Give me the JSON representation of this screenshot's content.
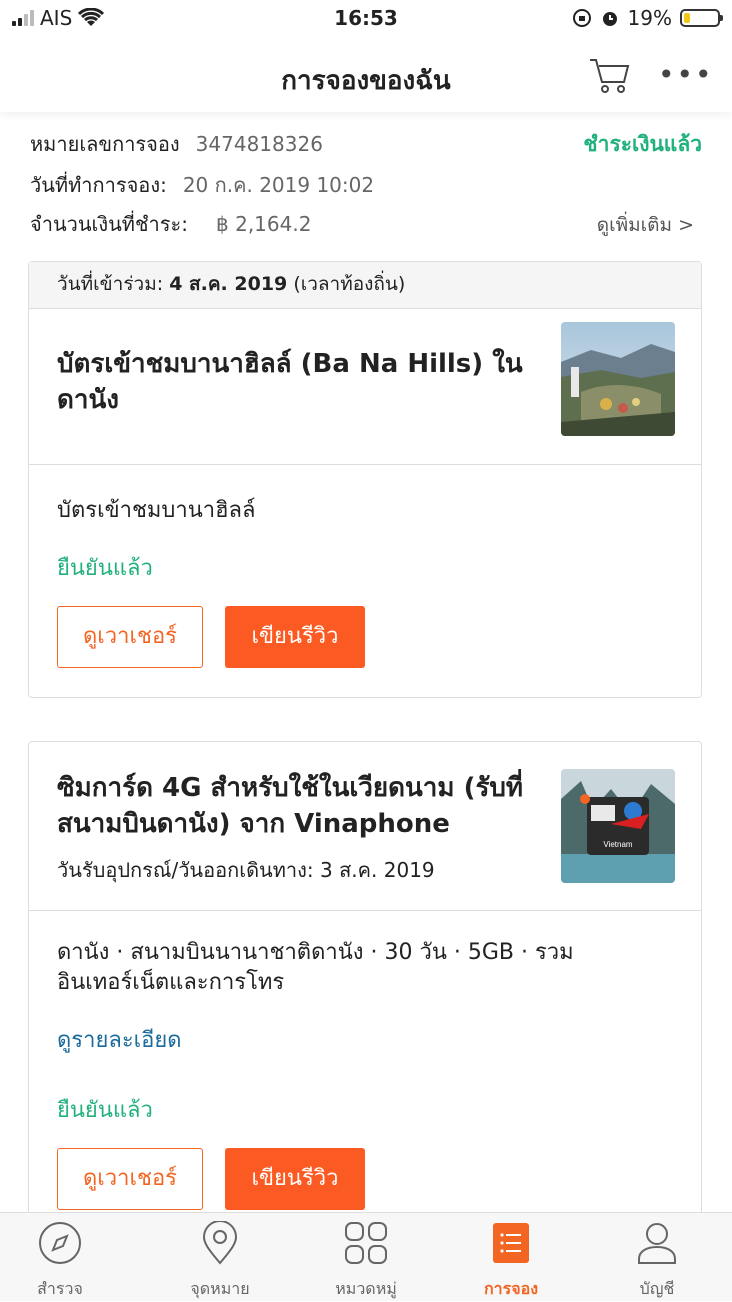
{
  "status_bar": {
    "carrier": "AIS",
    "time": "16:53",
    "battery": "19%",
    "battery_level": 0.19
  },
  "header": {
    "title": "การจองของฉัน",
    "cart_icon": "cart-icon",
    "more_icon": "more-icon"
  },
  "booking": {
    "number_label": "หมายเลขการจอง",
    "number": "3474818326",
    "status": "ชำระเงินแล้ว",
    "date_label": "วันที่ทำการจอง:",
    "date": "20 ก.ค. 2019 10:02",
    "amount_label": "จำนวนเงินที่ชำระ:",
    "amount": "฿ 2,164.2",
    "more_label": "ดูเพิ่มเติม >"
  },
  "items": [
    {
      "date_prefix": "วันที่เข้าร่วม:",
      "date_value": "4 ส.ค. 2019",
      "date_suffix": "(เวลาท้องถิ่น)",
      "title": "บัตรเข้าชมบานาฮิลล์ (Ba Na Hills) ใน ดานัง",
      "package": "บัตรเข้าชมบานาฮิลล์",
      "status": "ยืนยันแล้ว",
      "voucher_button": "ดูเวาเชอร์",
      "review_button": "เขียนรีวิว"
    },
    {
      "title": "ซิมการ์ด 4G สำหรับใช้ในเวียดนาม (รับที่ สนามบินดานัง) จาก Vinaphone",
      "pickup": "วันรับอุปกรณ์/วันออกเดินทาง: 3 ส.ค. 2019",
      "package": "ดานัง · สนามบินนานาชาติดานัง · 30 วัน · 5GB · รวม อินเทอร์เน็ตและการโทร",
      "details_link": "ดูรายละเอียด",
      "status": "ยืนยันแล้ว",
      "voucher_button": "ดูเวาเชอร์",
      "review_button": "เขียนรีวิว",
      "thumb_label": "Vietnam"
    }
  ],
  "tabbar": [
    {
      "label": "สำรวจ",
      "icon": "compass-icon"
    },
    {
      "label": "จุดหมาย",
      "icon": "map-pin-icon"
    },
    {
      "label": "หมวดหมู่",
      "icon": "grid-icon"
    },
    {
      "label": "การจอง",
      "icon": "bookings-list-icon",
      "active": true
    },
    {
      "label": "บัญชี",
      "icon": "user-icon"
    }
  ]
}
